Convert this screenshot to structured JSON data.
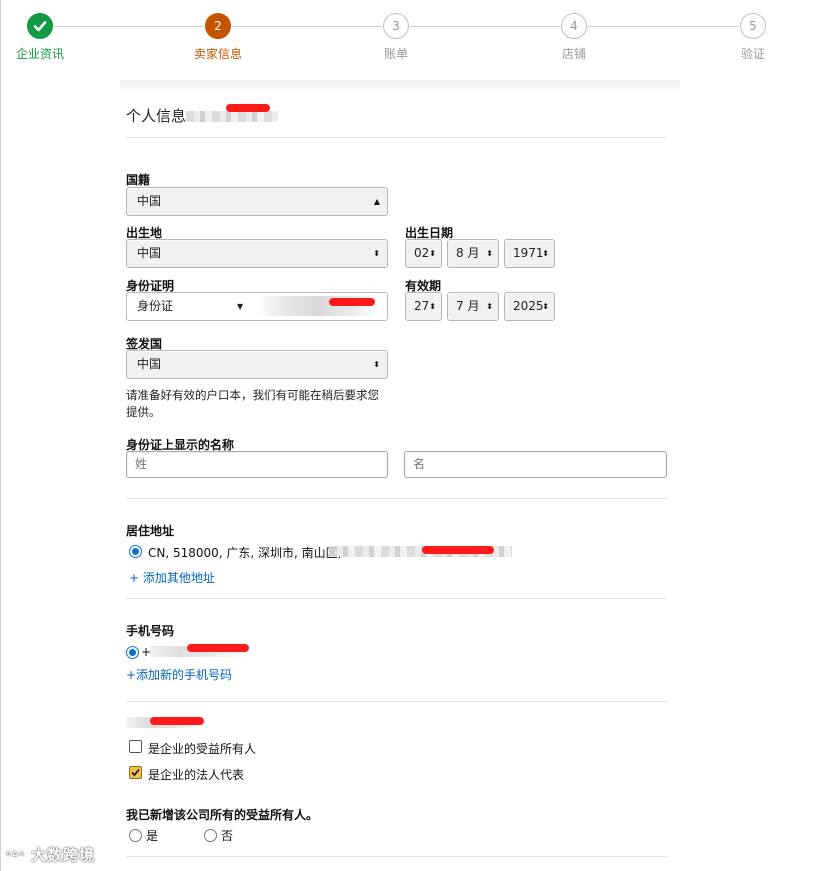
{
  "stepper": {
    "steps": [
      {
        "num": "",
        "label": "企业资讯",
        "state": "done"
      },
      {
        "num": "2",
        "label": "卖家信息",
        "state": "current"
      },
      {
        "num": "3",
        "label": "账单",
        "state": "todo"
      },
      {
        "num": "4",
        "label": "店铺",
        "state": "todo"
      },
      {
        "num": "5",
        "label": "验证",
        "state": "todo"
      }
    ]
  },
  "section": {
    "title": "个人信息"
  },
  "nationality": {
    "label": "国籍",
    "value": "中国"
  },
  "birthplace": {
    "label": "出生地",
    "value": "中国"
  },
  "birthdate": {
    "label": "出生日期",
    "day": "02",
    "month": "8 月",
    "year": "1971"
  },
  "id_proof": {
    "label": "身份证明",
    "type": "身份证"
  },
  "expiry": {
    "label": "有效期",
    "day": "27",
    "month": "7 月",
    "year": "2025"
  },
  "issuing_country": {
    "label": "签发国",
    "value": "中国"
  },
  "notice": {
    "line1": "请准备好有效的户口本，我们有可能在稍后要求您",
    "line2": "提供。"
  },
  "id_name": {
    "label": "身份证上显示的名称",
    "last_placeholder": "姓",
    "first_placeholder": "名"
  },
  "residence": {
    "label": "居住地址",
    "address": "CN, 518000, 广东, 深圳市, 南山区,",
    "add_link": "+ 添加其他地址"
  },
  "phone": {
    "label": "手机号码",
    "prefix": "+",
    "add_link": "+添加新的手机号码"
  },
  "roles": {
    "beneficial_owner": "是企业的受益所有人",
    "legal_rep": "是企业的法人代表"
  },
  "owners_added": {
    "question": "我已新增该公司所有的受益所有人。",
    "yes": "是",
    "no": "否"
  },
  "watermark": "大数跨境",
  "colors": {
    "done": "#129b44",
    "current": "#c45500",
    "link": "#0066c0",
    "radio": "#0b6fd6",
    "checkbox": "#f0c14b"
  }
}
